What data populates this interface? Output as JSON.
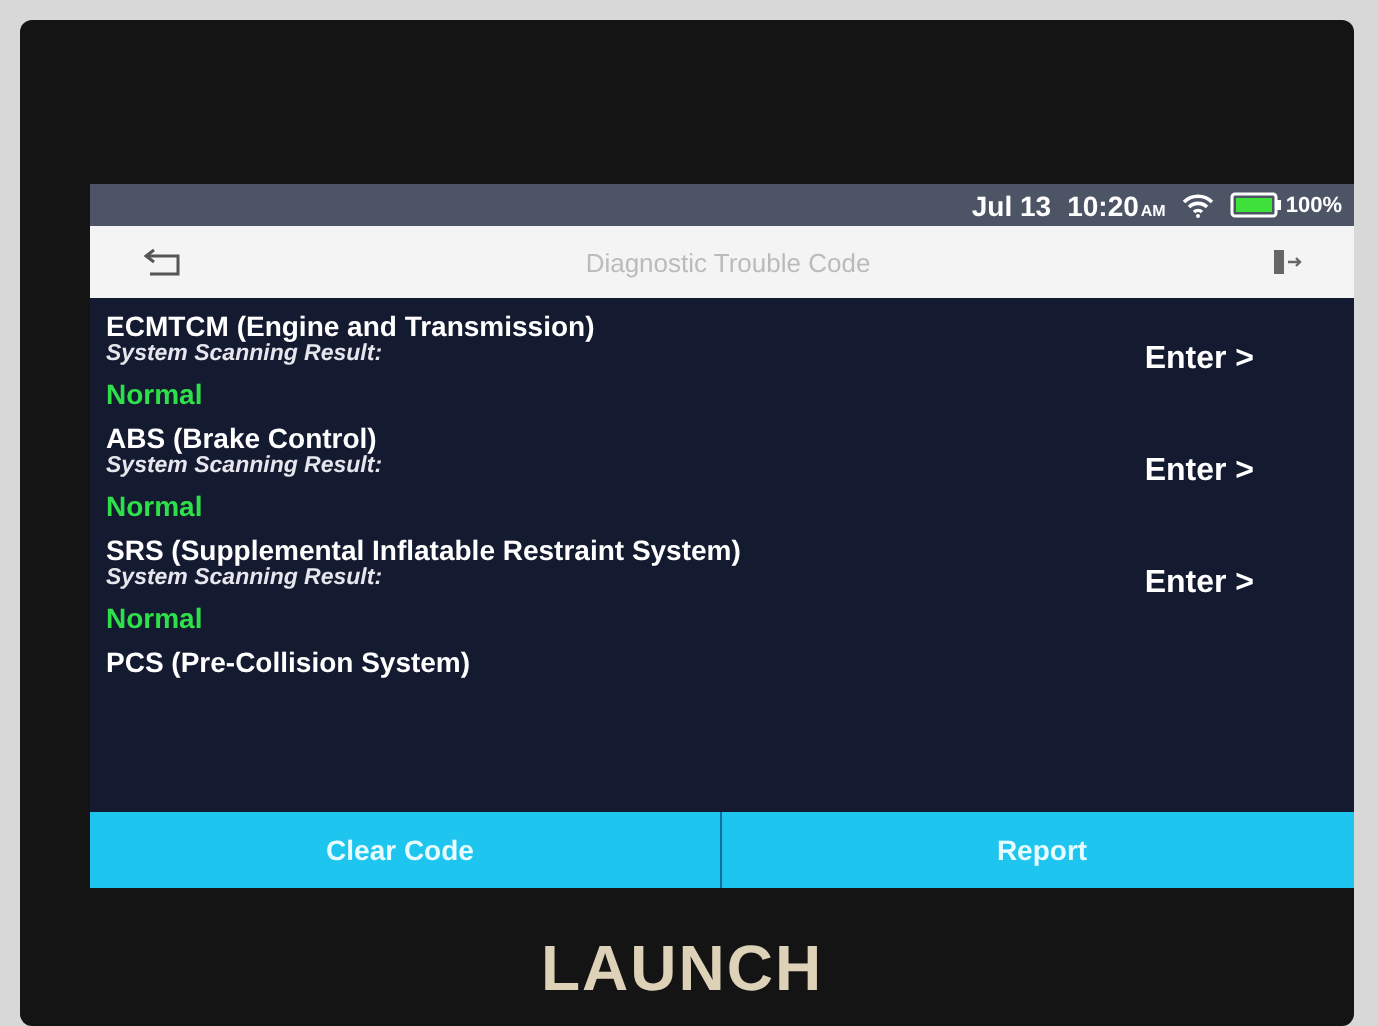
{
  "status_bar": {
    "date": "Jul 13",
    "time": "10:20",
    "ampm": "AM",
    "battery": "100%"
  },
  "title_bar": {
    "title": "Diagnostic Trouble Code"
  },
  "systems": [
    {
      "name": "ECMTCM (Engine and Transmission)",
      "result_label": "System Scanning Result:",
      "result": "Normal",
      "action": "Enter >"
    },
    {
      "name": "ABS (Brake Control)",
      "result_label": "System Scanning Result:",
      "result": "Normal",
      "action": "Enter >"
    },
    {
      "name": "SRS (Supplemental Inflatable Restraint System)",
      "result_label": "System Scanning Result:",
      "result": "Normal",
      "action": "Enter >"
    },
    {
      "name": "PCS (Pre-Collision System)"
    }
  ],
  "buttons": [
    {
      "label": "Clear Code"
    },
    {
      "label": "Report"
    }
  ],
  "brand": "LAUNCH"
}
